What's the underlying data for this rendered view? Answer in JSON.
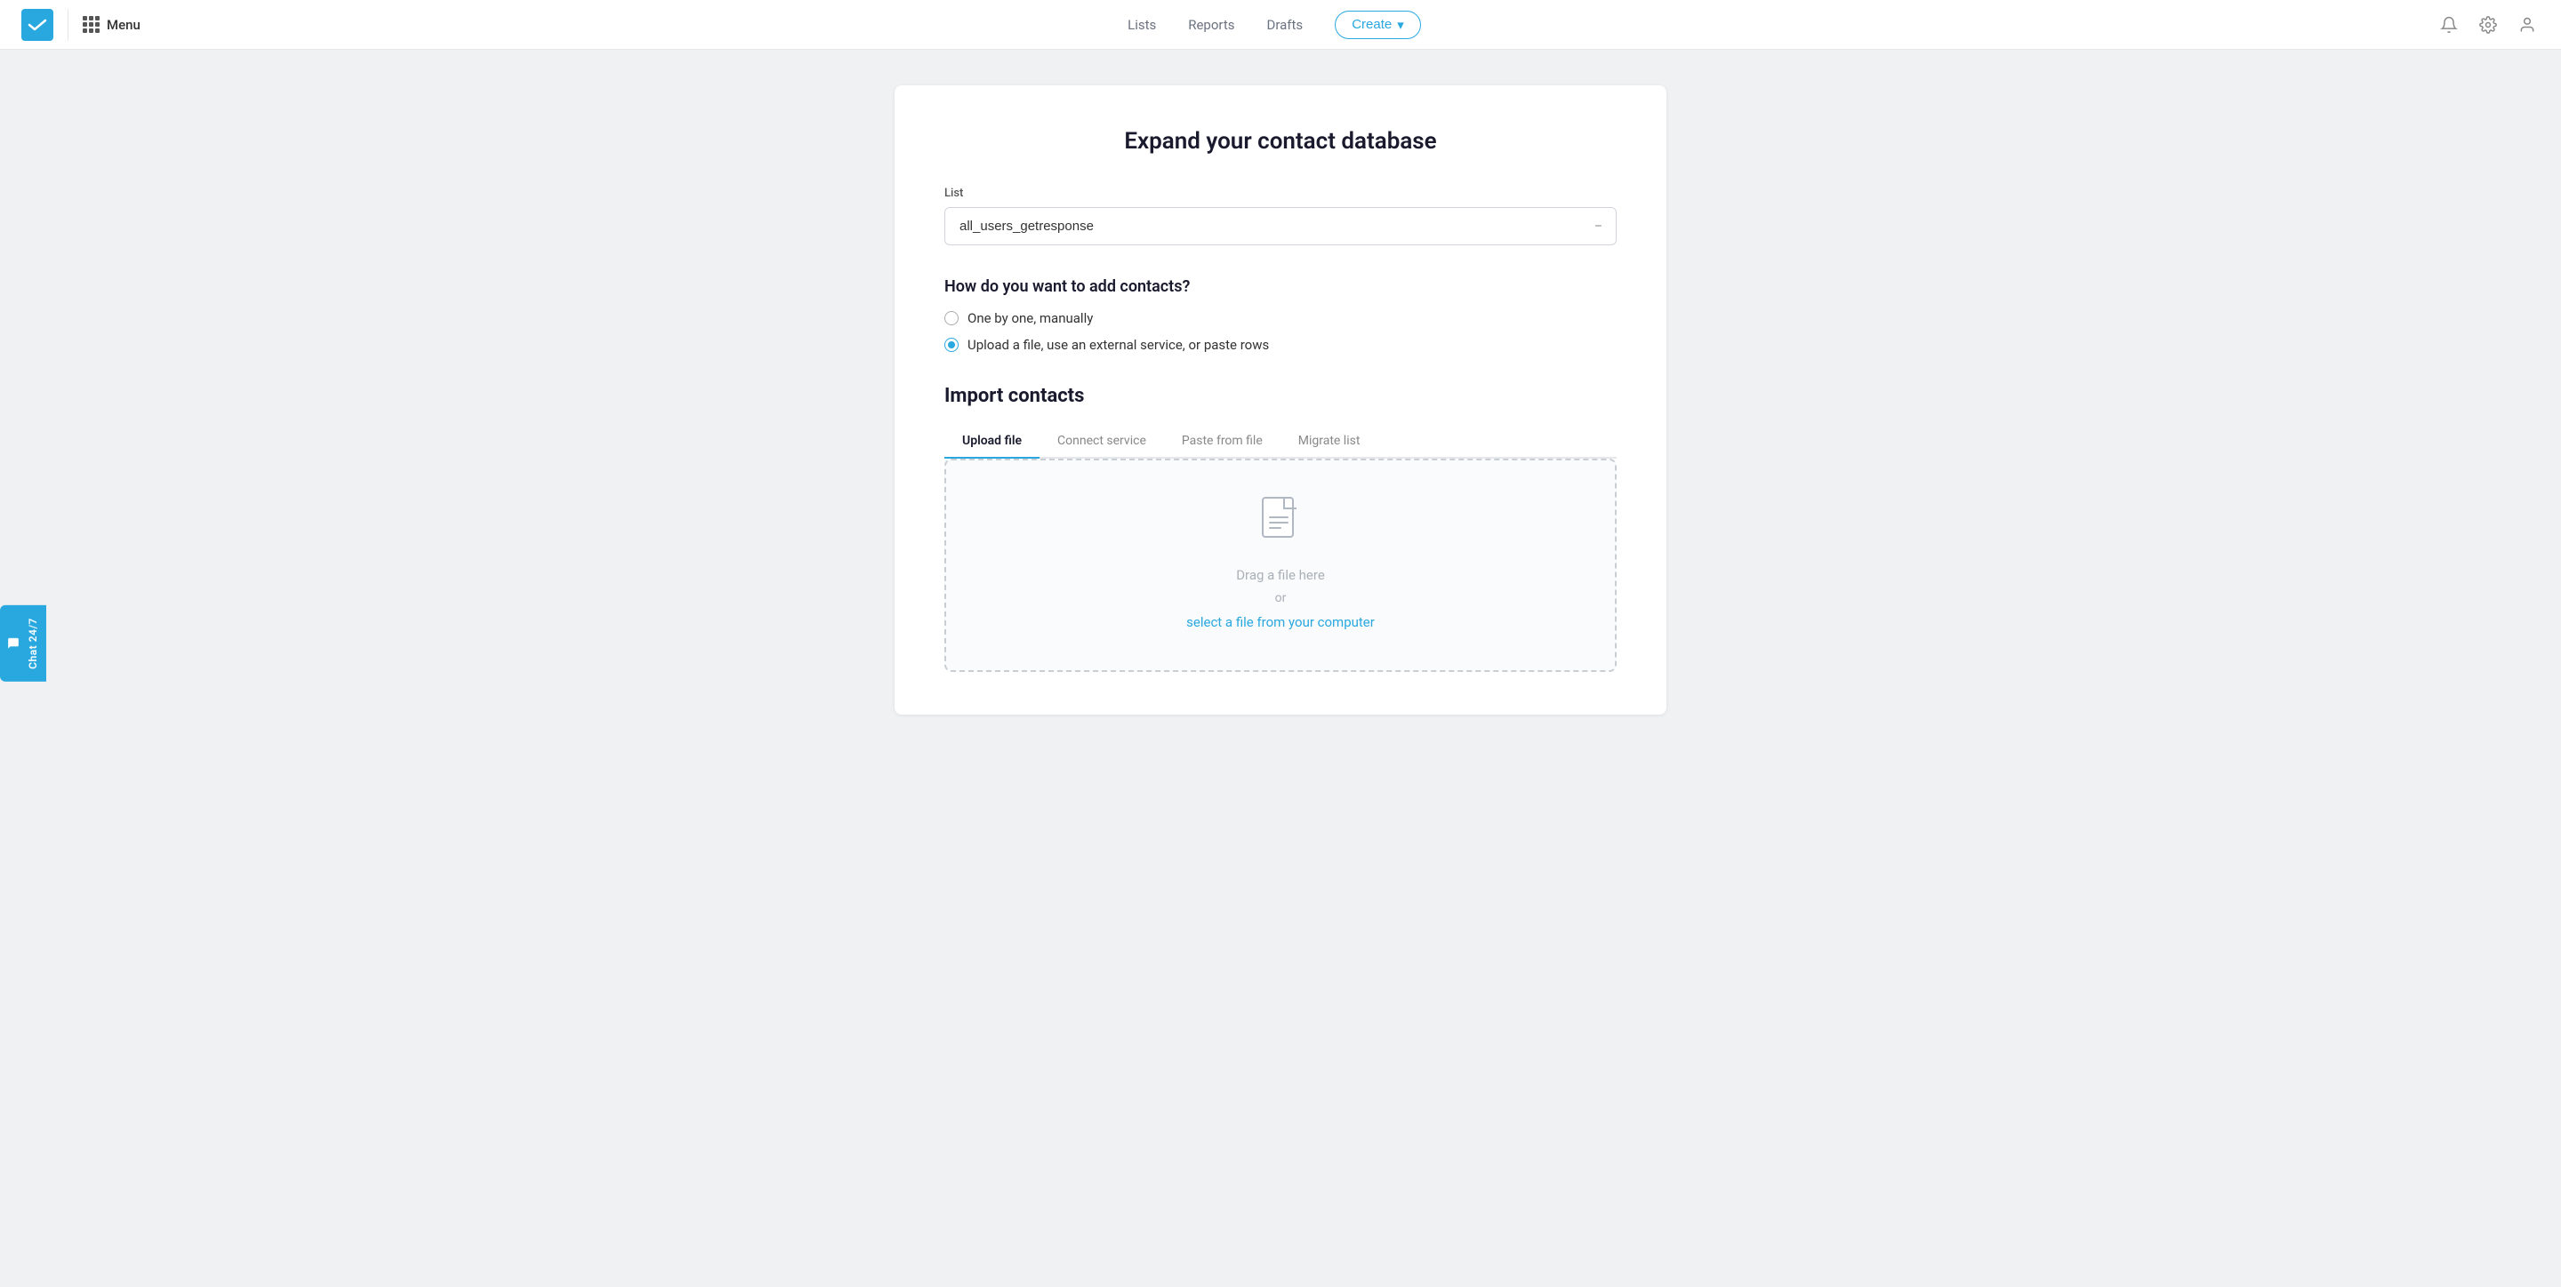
{
  "header": {
    "logo_alt": "GetResponse logo",
    "menu_label": "Menu",
    "nav": [
      {
        "label": "Lists",
        "id": "lists"
      },
      {
        "label": "Reports",
        "id": "reports"
      },
      {
        "label": "Drafts",
        "id": "drafts"
      }
    ],
    "create_label": "Create",
    "create_arrow": "▾"
  },
  "card": {
    "title": "Expand your contact database",
    "list_label": "List",
    "list_value": "all_users_getresponse",
    "list_placeholder": "all_users_getresponse",
    "question": "How do you want to add contacts?",
    "options": [
      {
        "id": "manual",
        "label": "One by one, manually",
        "checked": false
      },
      {
        "id": "upload",
        "label": "Upload a file, use an external service, or paste rows",
        "checked": true
      }
    ],
    "import_title": "Import contacts",
    "tabs": [
      {
        "id": "upload-file",
        "label": "Upload file",
        "active": true
      },
      {
        "id": "connect-service",
        "label": "Connect service",
        "active": false
      },
      {
        "id": "paste-from-file",
        "label": "Paste from file",
        "active": false
      },
      {
        "id": "migrate-list",
        "label": "Migrate list",
        "active": false
      }
    ],
    "dropzone": {
      "main_text": "Drag a file here",
      "or_text": "or",
      "link_text": "select a file from your computer"
    }
  },
  "chat_widget": {
    "label": "Chat 24/7"
  }
}
